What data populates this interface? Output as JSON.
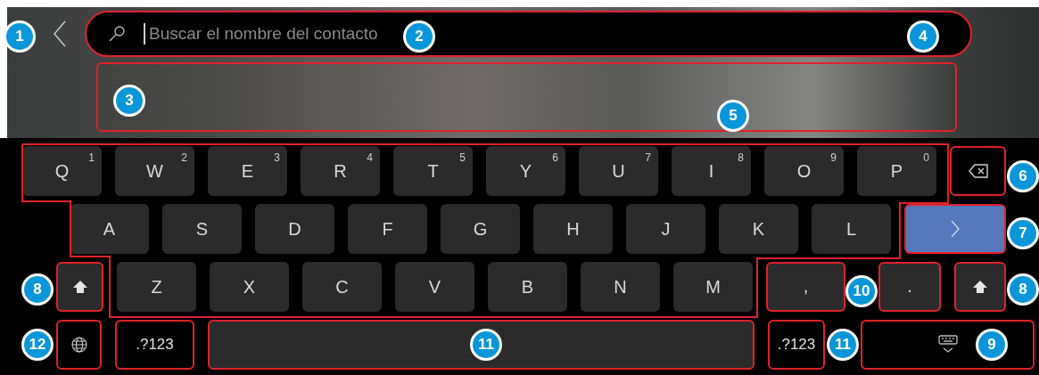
{
  "search": {
    "placeholder": "Buscar el nombre del contacto",
    "highlighted": true
  },
  "suggestions": {
    "highlighted": true
  },
  "keyboard": {
    "rows": [
      {
        "keys": [
          {
            "kind": "letter",
            "label": "Q",
            "hint": "1"
          },
          {
            "kind": "letter",
            "label": "W",
            "hint": "2"
          },
          {
            "kind": "letter",
            "label": "E",
            "hint": "3"
          },
          {
            "kind": "letter",
            "label": "R",
            "hint": "4"
          },
          {
            "kind": "letter",
            "label": "T",
            "hint": "5"
          },
          {
            "kind": "letter",
            "label": "Y",
            "hint": "6"
          },
          {
            "kind": "letter",
            "label": "U",
            "hint": "7"
          },
          {
            "kind": "letter",
            "label": "I",
            "hint": "8"
          },
          {
            "kind": "letter",
            "label": "O",
            "hint": "9"
          },
          {
            "kind": "letter",
            "label": "P",
            "hint": "0"
          },
          {
            "kind": "backspace",
            "highlighted": true
          }
        ]
      },
      {
        "keys": [
          {
            "kind": "letter",
            "label": "A"
          },
          {
            "kind": "letter",
            "label": "S"
          },
          {
            "kind": "letter",
            "label": "D"
          },
          {
            "kind": "letter",
            "label": "F"
          },
          {
            "kind": "letter",
            "label": "G"
          },
          {
            "kind": "letter",
            "label": "H"
          },
          {
            "kind": "letter",
            "label": "J"
          },
          {
            "kind": "letter",
            "label": "K"
          },
          {
            "kind": "letter",
            "label": "L"
          },
          {
            "kind": "enter",
            "highlighted": true
          }
        ]
      },
      {
        "keys": [
          {
            "kind": "shift",
            "highlighted": true
          },
          {
            "kind": "letter",
            "label": "Z"
          },
          {
            "kind": "letter",
            "label": "X"
          },
          {
            "kind": "letter",
            "label": "C"
          },
          {
            "kind": "letter",
            "label": "V"
          },
          {
            "kind": "letter",
            "label": "B"
          },
          {
            "kind": "letter",
            "label": "N"
          },
          {
            "kind": "letter",
            "label": "M"
          },
          {
            "kind": "punct",
            "label": ",",
            "highlighted": true
          },
          {
            "kind": "punct",
            "label": ".",
            "highlighted": true
          },
          {
            "kind": "shift",
            "highlighted": true
          }
        ]
      },
      {
        "keys": [
          {
            "kind": "globe",
            "highlighted": true
          },
          {
            "kind": "symbols",
            "label": ".?123",
            "highlighted": true
          },
          {
            "kind": "space",
            "highlighted": true
          },
          {
            "kind": "symbols",
            "label": ".?123",
            "highlighted": true
          },
          {
            "kind": "hide",
            "highlighted": true
          }
        ]
      }
    ]
  },
  "callouts": [
    {
      "label": "1"
    },
    {
      "label": "2"
    },
    {
      "label": "4"
    },
    {
      "label": "3"
    },
    {
      "label": "5"
    },
    {
      "label": "6"
    },
    {
      "label": "7"
    },
    {
      "label": "8"
    },
    {
      "label": "10"
    },
    {
      "label": "8"
    },
    {
      "label": "12"
    },
    {
      "label": "11"
    },
    {
      "label": "11"
    },
    {
      "label": "9"
    }
  ]
}
